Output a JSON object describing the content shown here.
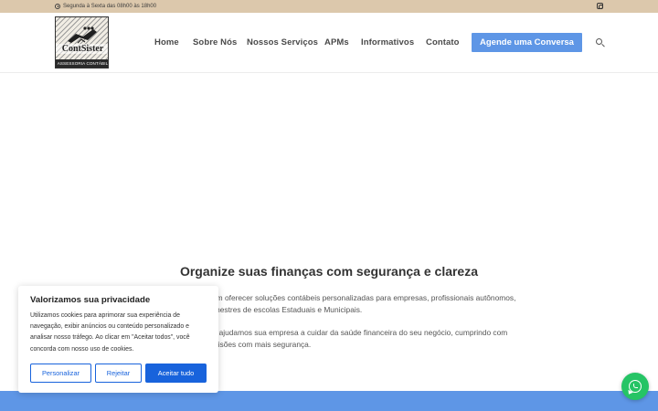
{
  "topbar": {
    "hours": "Segunda à Sexta das 08h00 às 18h00",
    "hours_icon": "clock-icon",
    "social_icon": "instagram-icon"
  },
  "logo": {
    "brand": "ContSister",
    "subtitle": "ASSESSORIA CONTÁBIL"
  },
  "nav": {
    "items": [
      "Home",
      "Sobre Nós",
      "Nossos Serviços",
      "APMs",
      "Informativos",
      "Contato"
    ],
    "cta": "Agende uma Conversa",
    "search_icon": "search-icon"
  },
  "main": {
    "title": "Organize suas finanças com segurança e clareza",
    "para1_line1": "pecializados em oferecer soluções contábeis personalizadas para empresas, profissionais autônomos,",
    "para1_line2": "ais e mestres de escolas Estaduais e Municipais.",
    "para2_line1": "dade e parceria, ajudamos sua empresa a cuidar da saúde financeira do seu negócio, cumprindo com",
    "para2_line2": "ecisões com mais segurança."
  },
  "cookie": {
    "title": "Valorizamos sua privacidade",
    "text": "Utilizamos cookies para aprimorar sua experiência de navegação, exibir anúncios ou conteúdo personalizado e analisar nosso tráfego. Ao clicar em \"Aceitar todos\", você concorda com nosso uso de cookies.",
    "customize": "Personalizar",
    "reject": "Rejeitar",
    "accept": "Aceitar tudo"
  },
  "colors": {
    "topbar": "#dcc8ac",
    "accent": "#5e96e6",
    "cookie_button": "#1863dc",
    "whatsapp": "#25c465"
  },
  "whatsapp_icon": "whatsapp-icon"
}
